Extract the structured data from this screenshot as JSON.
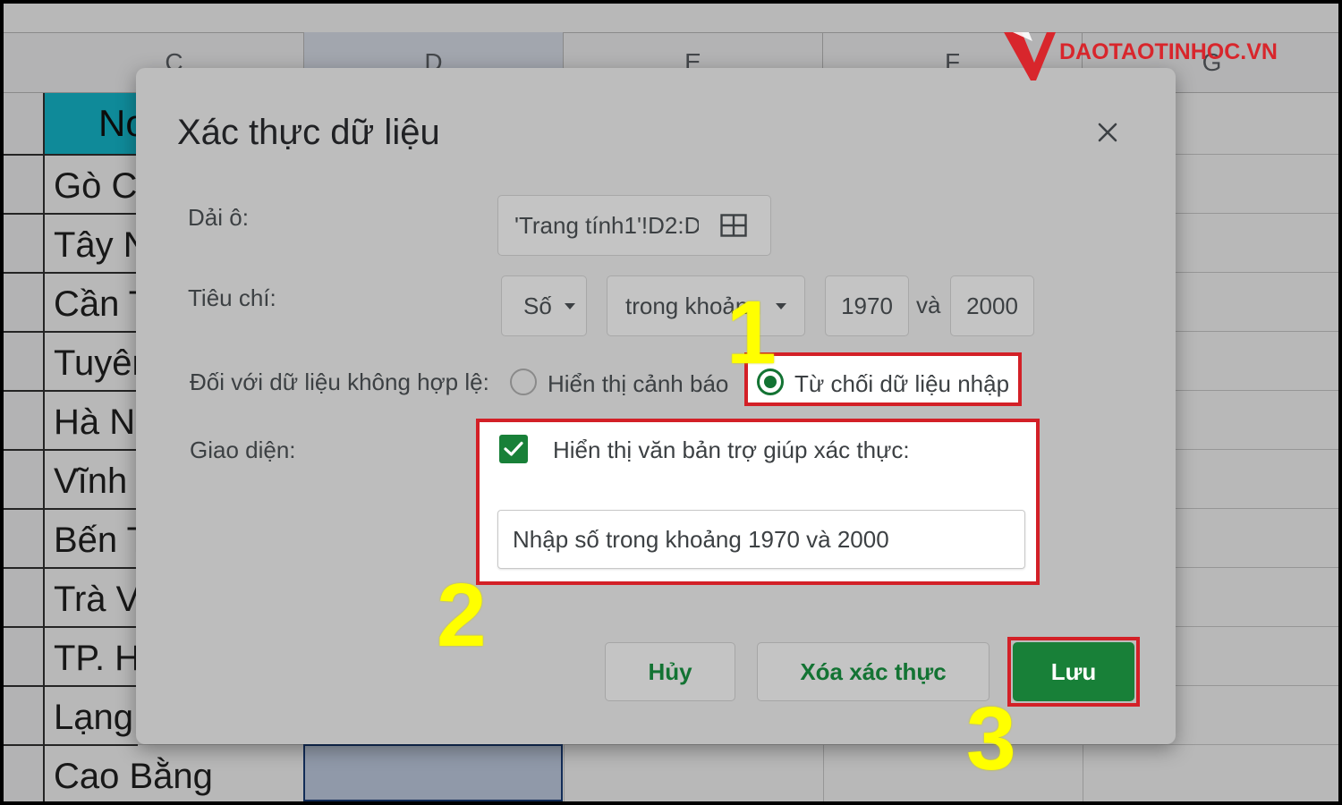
{
  "sheet": {
    "columns": [
      "C",
      "D",
      "E",
      "F",
      "G"
    ],
    "header_cell": "No",
    "rows": [
      "Gò Cô",
      "Tây N",
      "Cần T",
      "Tuyên",
      "Hà No",
      "Vĩnh",
      "Bến T",
      "Trà V",
      "TP. H",
      "Lạng",
      "Cao Bằng"
    ]
  },
  "dialog": {
    "title": "Xác thực dữ liệu",
    "close_glyph": "×",
    "range": {
      "label": "Dải ô:",
      "value": "'Trang tính1'!D2:D"
    },
    "criteria": {
      "label": "Tiêu chí:",
      "type": "Số",
      "condition": "trong khoảng",
      "min": "1970",
      "conjunction": "và",
      "max": "2000"
    },
    "invalid": {
      "label": "Đối với dữ liệu không hợp lệ:",
      "option_warn": "Hiển thị cảnh báo",
      "option_reject": "Từ chối dữ liệu nhập",
      "selected": "reject"
    },
    "appearance": {
      "label": "Giao diện:",
      "checkbox_label": "Hiển thị văn bản trợ giúp xác thực:",
      "checked": true,
      "help_text": "Nhập số trong khoảng 1970 và 2000"
    },
    "buttons": {
      "cancel": "Hủy",
      "remove": "Xóa xác thực",
      "save": "Lưu"
    }
  },
  "annotations": {
    "step1": "1",
    "step2": "2",
    "step3": "3"
  },
  "logo": {
    "text": "DAOTAOTINHOC.VN",
    "color": "#d8262c"
  },
  "colors": {
    "accent": "#188038",
    "highlight": "#d32027",
    "step": "#ffff00",
    "header_fill": "#16bfd4"
  }
}
